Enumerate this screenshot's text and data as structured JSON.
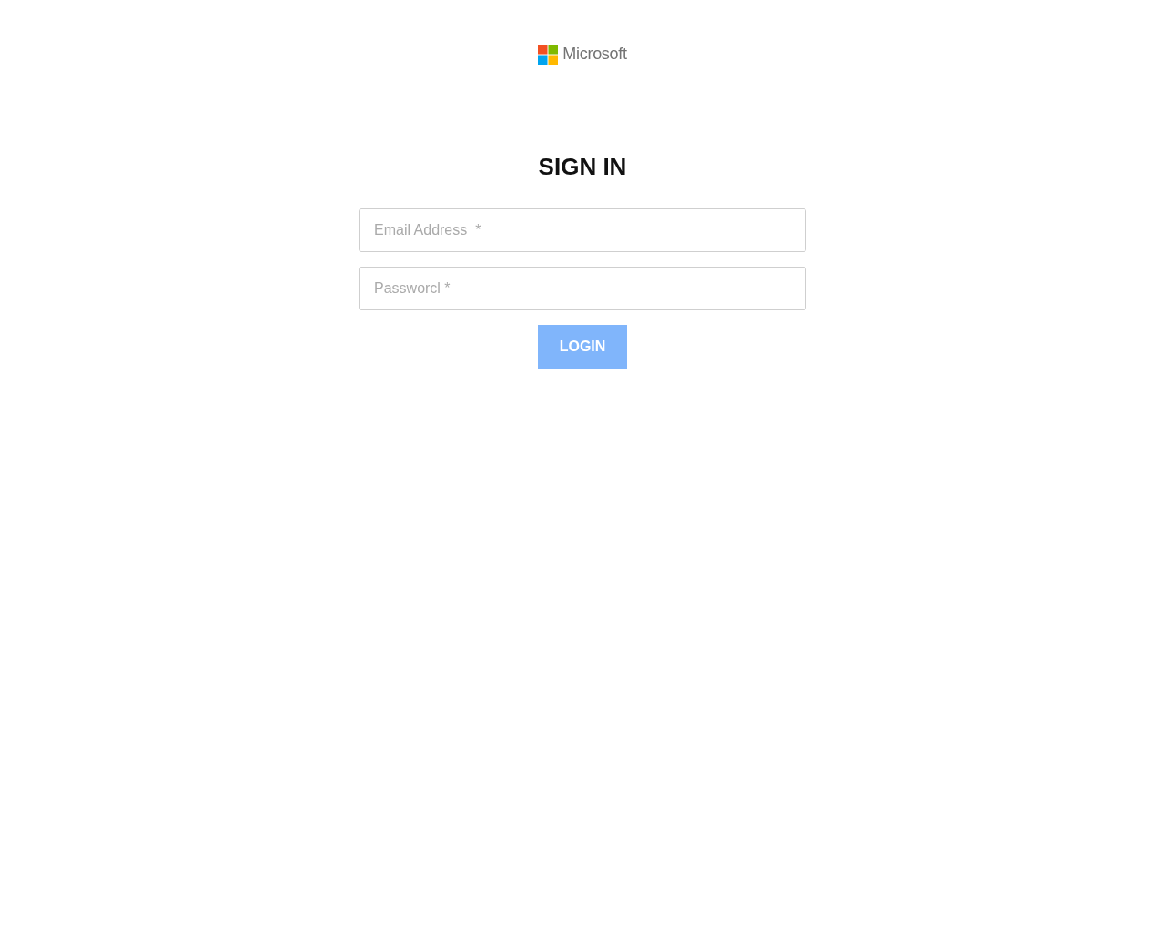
{
  "logo": {
    "text": "Microsoft"
  },
  "heading": "SIGN IN",
  "fields": [
    {
      "placeholder": "Email Address  *"
    },
    {
      "placeholder": "Passworcl *"
    }
  ],
  "login_button": {
    "label": "LOGIN",
    "disabled": true
  }
}
